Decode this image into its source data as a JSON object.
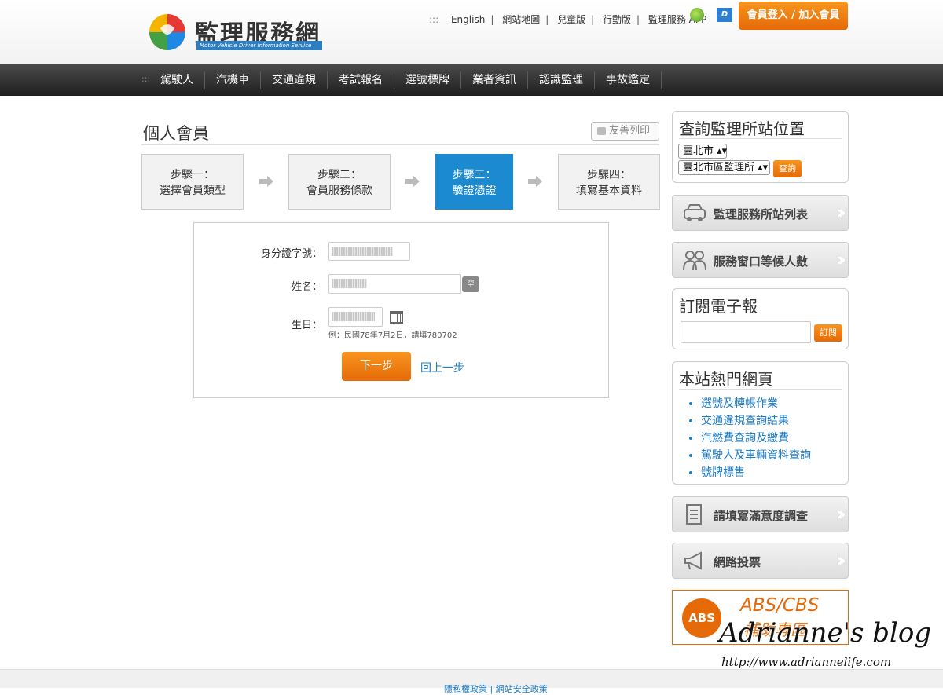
{
  "header": {
    "logo_title": "監理服務網",
    "logo_subtitle": "Motor Vehicle Driver Information Service",
    "top_links": [
      "English",
      "網站地圖",
      "兒童版",
      "行動版",
      "監理服務 APP"
    ],
    "login_label": "會員登入 / 加入會員"
  },
  "nav": {
    "items": [
      "駕駛人",
      "汽機車",
      "交通違規",
      "考試報名",
      "選號標牌",
      "業者資訊",
      "認識監理",
      "事故鑑定"
    ]
  },
  "main": {
    "page_title": "個人會員",
    "print_label": "友善列印",
    "steps": [
      {
        "line1": "步驟一：",
        "line2": "選擇會員類型"
      },
      {
        "line1": "步驟二：",
        "line2": "會員服務條款"
      },
      {
        "line1": "步驟三：",
        "line2": "驗證憑證"
      },
      {
        "line1": "步驟四：",
        "line2": "填寫基本資料"
      }
    ],
    "active_step": 3,
    "form": {
      "id_label": "身分證字號：",
      "name_label": "姓名：",
      "birthday_label": "生日：",
      "rare_char_label": "罕",
      "birthday_hint": "例：民國78年7月2日，請填780702",
      "next_label": "下一步",
      "prev_label": "回上一步"
    }
  },
  "sidebar": {
    "office_title": "查詢監理所站位置",
    "city_value": "臺北市",
    "office_value": "臺北市區監理所",
    "query_label": "查詢",
    "station_list_label": "監理服務所站列表",
    "waiting_label": "服務窗口等候人數",
    "newsletter_title": "訂閱電子報",
    "subscribe_label": "訂閱",
    "hot_title": "本站熱門網頁",
    "hot_links": [
      "選號及轉帳作業",
      "交通違規查詢結果",
      "汽燃費查詢及繳費",
      "駕駛人及車輛資料查詢",
      "號牌標售"
    ],
    "survey_label": "請填寫滿意度調查",
    "vote_label": "網路投票",
    "abs_badge": "ABS",
    "abs_title": "ABS/CBS",
    "abs_subtitle": "補助專區"
  },
  "watermark": {
    "title": "Adrianne's blog",
    "url": "http://www.adriannelife.com"
  },
  "footer": {
    "links": "隱私權政策 | 網站安全政策"
  },
  "colors": {
    "accent_orange": "#e56a07",
    "active_blue": "#1c8ad0",
    "link_blue": "#1c7cc8"
  }
}
